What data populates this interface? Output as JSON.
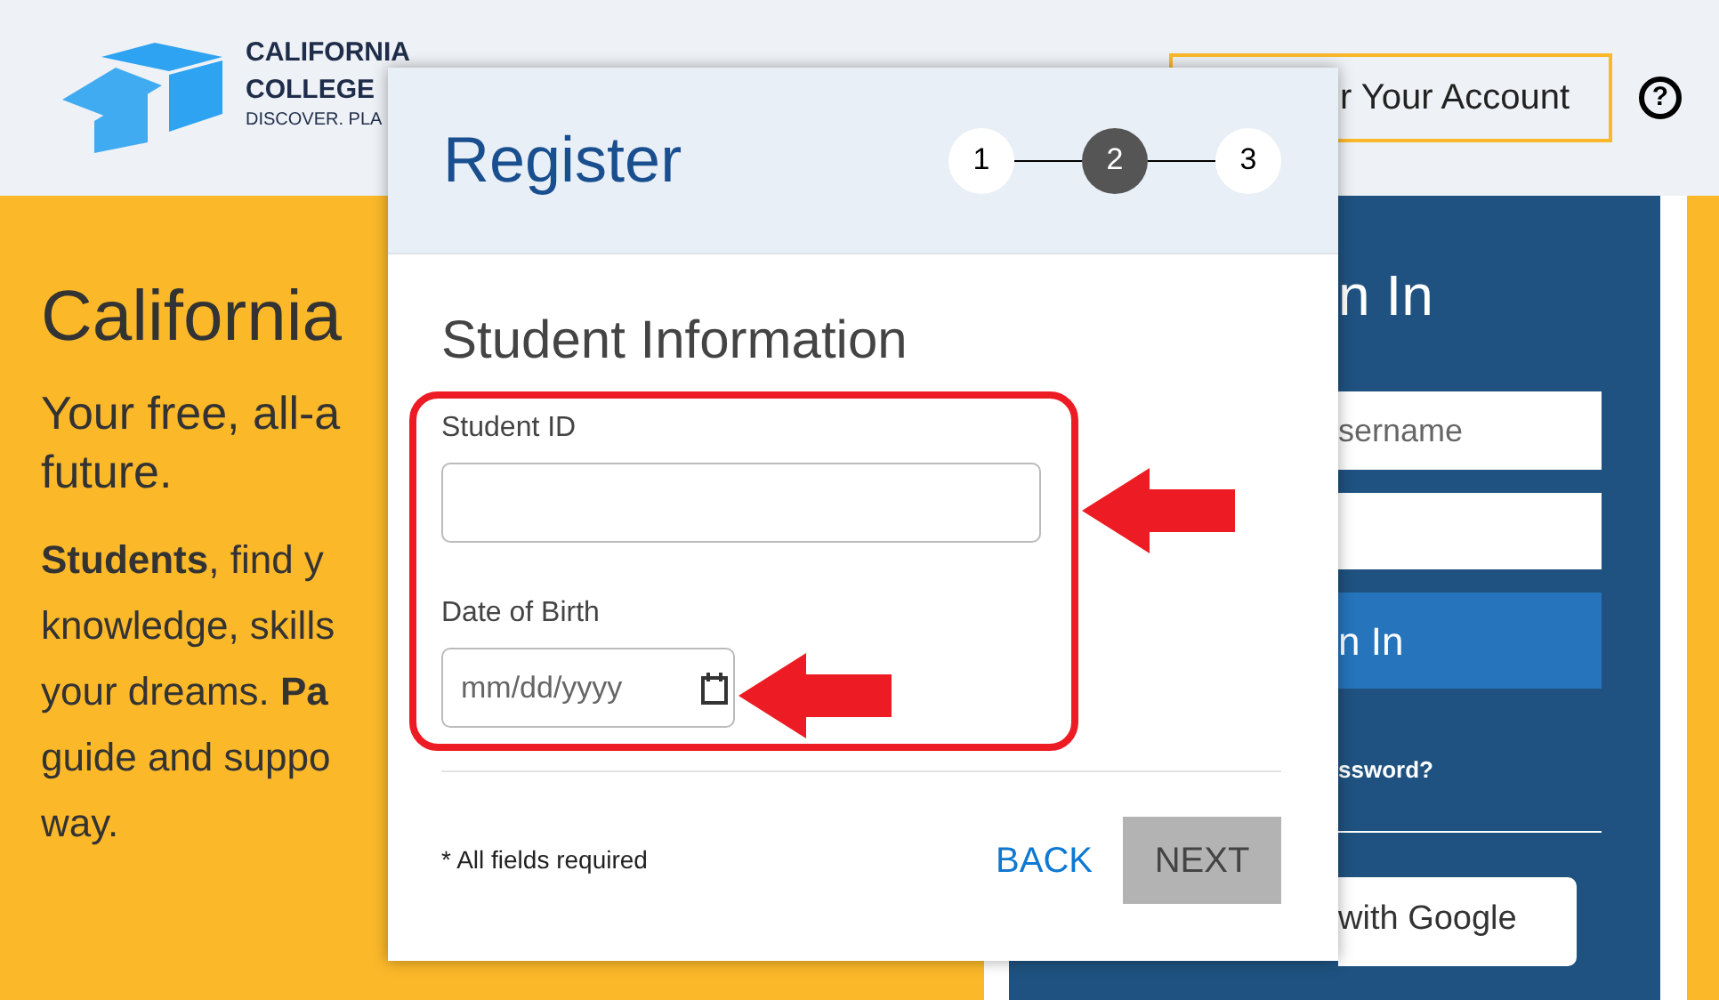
{
  "header": {
    "logo_lines": [
      "CALIFORNIA",
      "COLLEGE",
      "DISCOVER. PLA"
    ],
    "account_button": "r Your Account",
    "help_icon": "?"
  },
  "intro": {
    "title": "California",
    "lead": [
      "Your free, all-a",
      "future."
    ],
    "paragraph": [
      "**Students**, find y",
      "knowledge, skills",
      "your dreams. **Pa**",
      "guide and suppo",
      "way."
    ]
  },
  "sign_in": {
    "title": "n In",
    "username": {
      "placeholder": "sername"
    },
    "button": "n In",
    "forgot_link": "ssword?",
    "google_button": "with Google"
  },
  "modal": {
    "title": "Register",
    "steps": [
      {
        "label": "1",
        "selected": false
      },
      {
        "label": "2",
        "selected": true
      },
      {
        "label": "3",
        "selected": false
      }
    ],
    "section_title": "Student Information",
    "fields": [
      {
        "kind": "text",
        "label": "Student ID"
      },
      {
        "kind": "date",
        "label": "Date of Birth",
        "placeholder": "mm/dd/yyyy"
      }
    ],
    "note": "* All fields required",
    "back_button": "BACK",
    "next_button": {
      "label": "NEXT",
      "disabled": true
    }
  }
}
